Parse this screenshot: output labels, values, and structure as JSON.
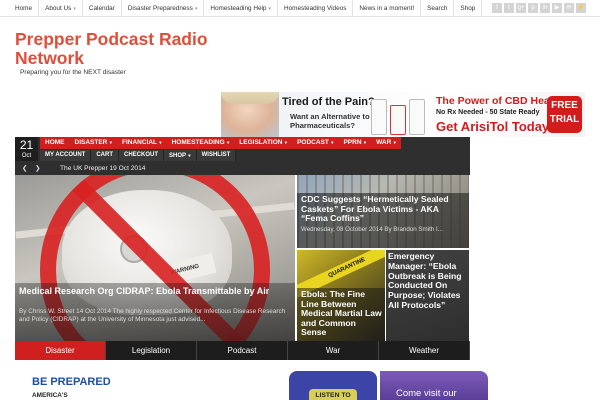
{
  "topnav": [
    {
      "label": "Home",
      "dropdown": false
    },
    {
      "label": "About Us",
      "dropdown": true
    },
    {
      "label": "Calendar",
      "dropdown": false
    },
    {
      "label": "Disaster Preparedness",
      "dropdown": true
    },
    {
      "label": "Homesteading Help",
      "dropdown": true
    },
    {
      "label": "Homesteading Videos",
      "dropdown": false
    },
    {
      "label": "News in a moment!",
      "dropdown": false
    },
    {
      "label": "Search",
      "dropdown": false
    },
    {
      "label": "Shop",
      "dropdown": false
    }
  ],
  "social_icons": [
    "f",
    "t",
    "g+",
    "p",
    "in",
    "▶",
    "✉",
    "⚡"
  ],
  "site": {
    "title": "Prepper Podcast Radio Network",
    "tagline": "Preparing you for the NEXT disaster"
  },
  "banner": {
    "question_1": "Tired of the Pain?",
    "question_2": "Want an Alternative to Pharmaceuticals?",
    "right_1": "The Power of CBD Health",
    "right_2": "No Rx Needed - 50 State Ready",
    "right_3": "Get ArisiTol Today",
    "free_trial": "FREE TRIAL"
  },
  "date": {
    "day": "21",
    "month": "Oct"
  },
  "mainnav": [
    {
      "label": "HOME",
      "dropdown": false
    },
    {
      "label": "DISASTER",
      "dropdown": true
    },
    {
      "label": "FINANCIAL",
      "dropdown": true
    },
    {
      "label": "HOMESTEADING",
      "dropdown": true
    },
    {
      "label": "LEGISLATION",
      "dropdown": true
    },
    {
      "label": "PODCAST",
      "dropdown": true
    },
    {
      "label": "PPRN",
      "dropdown": true
    },
    {
      "label": "WAR",
      "dropdown": true
    }
  ],
  "subnav": [
    {
      "label": "MY ACCOUNT",
      "dropdown": false
    },
    {
      "label": "CART",
      "dropdown": false
    },
    {
      "label": "CHECKOUT",
      "dropdown": false
    },
    {
      "label": "SHOP",
      "dropdown": true
    },
    {
      "label": "WISHLIST",
      "dropdown": false
    }
  ],
  "ticker": {
    "prev": "❮",
    "next": "❯",
    "text": "The UK Prepper 19 Oct 2014"
  },
  "feature": {
    "title": "Medical Research Org CIDRAP: Ebola Transmittable by Air",
    "excerpt": "By Chriss W. Street 14 Oct 2014 The highly respected Center for Infectious Disease Research and Policy (CIDRAP) at the University of Minnesota just advised...",
    "mask_label": "WARNING"
  },
  "story_top": {
    "title": "CDC Suggests “Hermetically Sealed Caskets” For Ebola Victims - AKA “Fema Coffins”",
    "meta": "Wednesday, 08 October 2014 By Brandon Smith   I..."
  },
  "story_bottom_left": {
    "title": "Ebola: The Fine Line Between Medical Martial Law and Common Sense",
    "tape_label": "QUARANTINE"
  },
  "story_bottom_right": {
    "title": "Emergency Manager: “Ebola Outbreak is Being Conducted On Purpose; Violates All Protocols”"
  },
  "category_tabs": [
    {
      "label": "Disaster",
      "active": true
    },
    {
      "label": "Legislation",
      "active": false
    },
    {
      "label": "Podcast",
      "active": false
    },
    {
      "label": "War",
      "active": false
    },
    {
      "label": "Weather",
      "active": false
    }
  ],
  "bottom": {
    "be_prepared": "BE PREPARED",
    "americas": "AMERICA'S",
    "listen_to": "LISTEN TO",
    "come_visit": "Come visit our"
  },
  "colors": {
    "accent_red": "#cf1f1f",
    "title_red": "#e04e39",
    "dark_bar": "#2f2f2f"
  }
}
